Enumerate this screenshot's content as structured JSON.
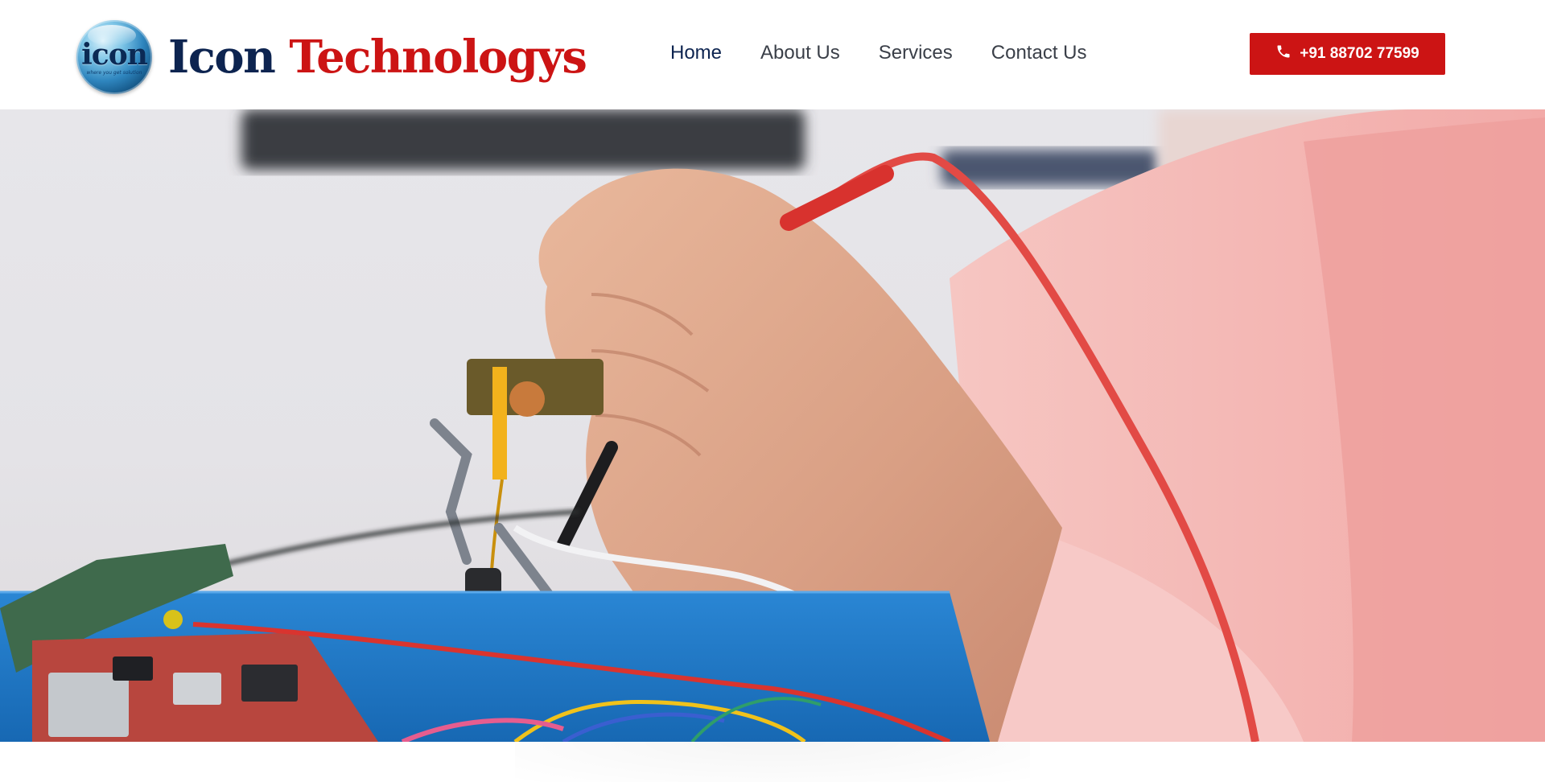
{
  "brand": {
    "logo_word": "icon",
    "logo_tagline": "where you get solution",
    "name_part1": "Icon",
    "name_part2": "Technologys"
  },
  "nav": {
    "items": [
      {
        "label": "Home",
        "active": true
      },
      {
        "label": "About Us",
        "active": false
      },
      {
        "label": "Services",
        "active": false
      },
      {
        "label": "Contact Us",
        "active": false
      }
    ]
  },
  "call_button": {
    "label": "+91 88702 77599",
    "icon": "phone-icon"
  },
  "colors": {
    "brand_navy": "#0d2450",
    "brand_red": "#cc1414",
    "nav_text": "#3a3f48"
  },
  "hero": {
    "image": "hands-testing-circuit-board-with-probes"
  }
}
